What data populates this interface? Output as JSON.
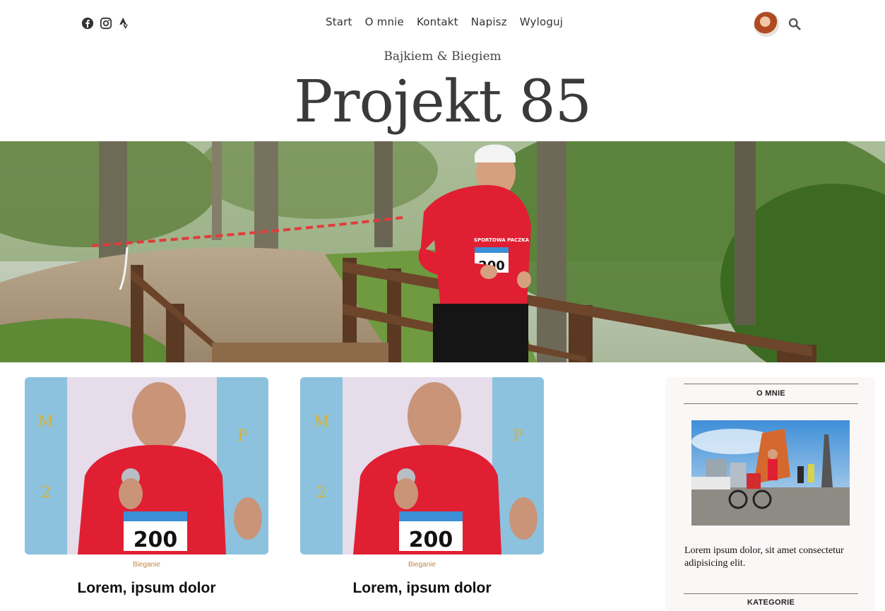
{
  "header": {
    "social_icons": [
      "facebook-icon",
      "instagram-icon",
      "strava-icon"
    ],
    "nav": [
      "Start",
      "O mnie",
      "Kontakt",
      "Napisz",
      "Wyloguj"
    ],
    "avatar_icon": "avatar",
    "search_icon": "search-icon"
  },
  "site": {
    "subtitle": "Bajkiem & Biegiem",
    "title": "Projekt 85"
  },
  "posts": [
    {
      "category": "Bieganie",
      "title": "Lorem, ipsum dolor",
      "bib": "200"
    },
    {
      "category": "Bieganie",
      "title": "Lorem, ipsum dolor",
      "bib": "200"
    }
  ],
  "sidebar": {
    "about_title": "O MNIE",
    "about_text": "Lorem ipsum dolor, sit amet consectetur adipisicing elit.",
    "categories_title": "KATEGORIE"
  },
  "colors": {
    "accent": "#c08a4a",
    "jersey": "#e01f33",
    "title": "#3a3a3a"
  }
}
